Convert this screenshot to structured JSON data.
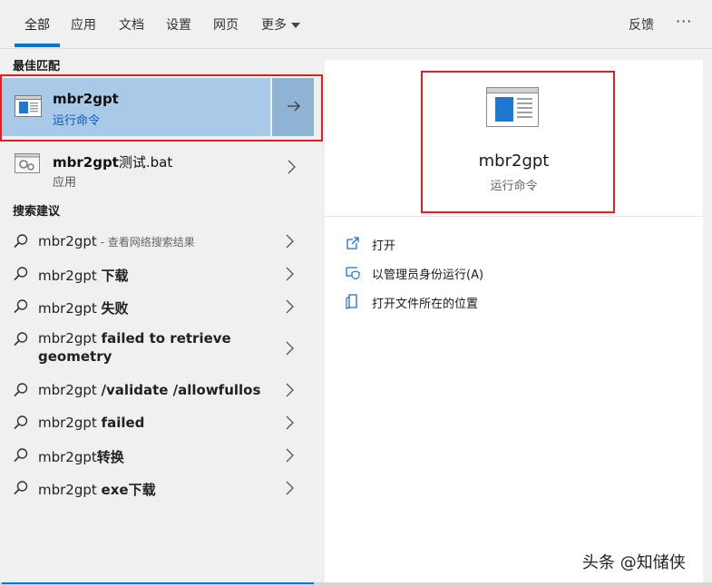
{
  "tabs": [
    {
      "label": "全部",
      "active": true
    },
    {
      "label": "应用"
    },
    {
      "label": "文档"
    },
    {
      "label": "设置"
    },
    {
      "label": "网页"
    },
    {
      "label": "更多"
    }
  ],
  "feedback_label": "反馈",
  "more_options": "···",
  "best_match": {
    "section_label": "最佳匹配",
    "title": "mbr2gpt",
    "subtitle": "运行命令"
  },
  "app_result": {
    "title_bold": "mbr2gpt",
    "title_rest": "测试.bat",
    "subtitle": "应用"
  },
  "suggestions": {
    "section_label": "搜索建议",
    "items": [
      {
        "prefix": "mbr2gpt",
        "bold": "",
        "hint": " - 查看网络搜索结果"
      },
      {
        "prefix": "mbr2gpt ",
        "bold": "下载",
        "hint": ""
      },
      {
        "prefix": "mbr2gpt ",
        "bold": "失败",
        "hint": ""
      },
      {
        "prefix": "mbr2gpt ",
        "bold": "failed to retrieve",
        "line2": "geometry",
        "hint": ""
      },
      {
        "prefix": "mbr2gpt ",
        "bold": "/validate /allowfullos",
        "hint": ""
      },
      {
        "prefix": "mbr2gpt ",
        "bold": "failed",
        "hint": ""
      },
      {
        "prefix": "mbr2gpt",
        "bold": "转换",
        "hint": ""
      },
      {
        "prefix": "mbr2gpt ",
        "bold": "exe下载",
        "hint": ""
      }
    ]
  },
  "preview": {
    "title": "mbr2gpt",
    "subtitle": "运行命令"
  },
  "actions": [
    {
      "label": "打开",
      "icon": "open-icon"
    },
    {
      "label": "以管理员身份运行(A)",
      "icon": "shield-icon"
    },
    {
      "label": "打开文件所在的位置",
      "icon": "folder-location-icon"
    }
  ],
  "watermark": "头条 @知储侠",
  "colors": {
    "accent": "#0078d7",
    "selection": "#a8c9e8",
    "highlight_box": "#e02020",
    "link_blue": "#0a5bbf"
  }
}
